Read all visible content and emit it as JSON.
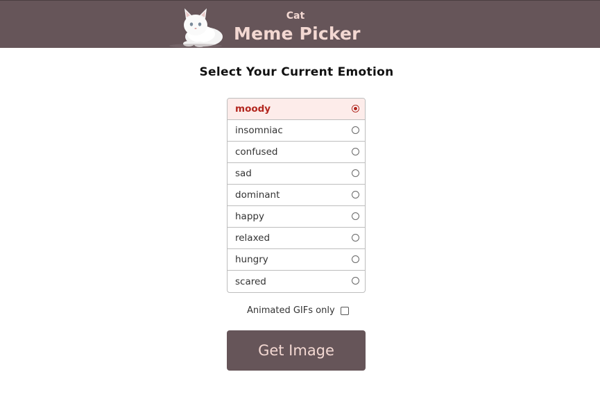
{
  "header": {
    "title_small": "Cat",
    "title_big": "Meme Picker",
    "logo_icon": "white-cat-logo"
  },
  "main": {
    "heading": "Select Your Current Emotion",
    "emotions": [
      {
        "label": "moody",
        "selected": true
      },
      {
        "label": "insomniac",
        "selected": false
      },
      {
        "label": "confused",
        "selected": false
      },
      {
        "label": "sad",
        "selected": false
      },
      {
        "label": "dominant",
        "selected": false
      },
      {
        "label": "happy",
        "selected": false
      },
      {
        "label": "relaxed",
        "selected": false
      },
      {
        "label": "hungry",
        "selected": false
      },
      {
        "label": "scared",
        "selected": false
      }
    ],
    "gif_label": "Animated GIFs only",
    "gif_checked": false,
    "button_label": "Get Image"
  },
  "colors": {
    "header_bg": "#665559",
    "title_text": "#f3d8d2",
    "selected_bg": "#fdecea",
    "selected_text": "#b3261e"
  }
}
